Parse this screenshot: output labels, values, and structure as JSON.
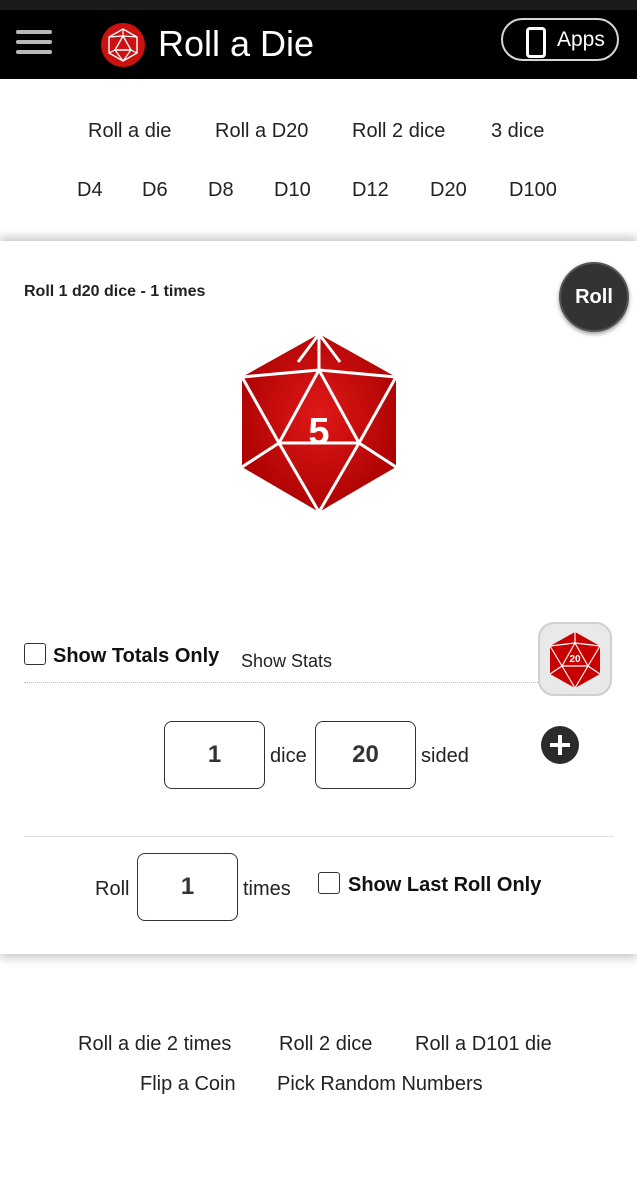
{
  "header": {
    "title": "Roll a Die",
    "apps_label": "Apps"
  },
  "nav": {
    "row1": [
      "Roll a die",
      "Roll a D20",
      "Roll 2 dice",
      "3 dice"
    ],
    "row2": [
      "D4",
      "D6",
      "D8",
      "D10",
      "D12",
      "D20",
      "D100"
    ]
  },
  "roller": {
    "heading": "Roll 1 d20 dice - 1 times",
    "roll_button": "Roll",
    "result": "5",
    "die_color": "#cc0000",
    "show_totals_label": "Show Totals Only",
    "show_totals_checked": false,
    "show_stats_label": "Show Stats",
    "thumb_label": "20",
    "dice_count": "1",
    "dice_label": "dice",
    "sides": "20",
    "sided_label": "sided",
    "roll_label": "Roll",
    "times_count": "1",
    "times_label": "times",
    "show_last_label": "Show Last Roll Only",
    "show_last_checked": false
  },
  "footer_links": {
    "row1": [
      "Roll a die 2 times",
      "Roll 2 dice",
      "Roll a D101 die"
    ],
    "row2": [
      "Flip a Coin",
      "Pick Random Numbers"
    ]
  }
}
